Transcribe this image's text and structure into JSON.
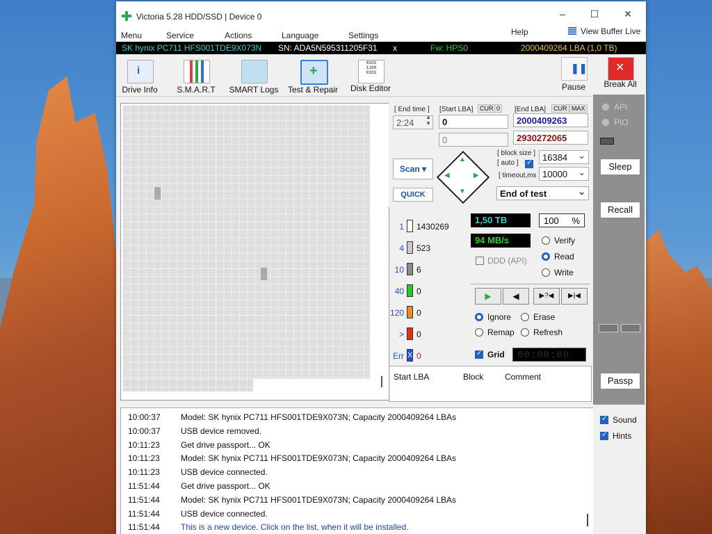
{
  "window": {
    "title": "Victoria 5.28 HDD/SSD | Device 0"
  },
  "menu": {
    "items": [
      "Menu",
      "Service",
      "Actions",
      "Language",
      "Settings"
    ],
    "help": "Help",
    "view_buffer": "View Buffer Live"
  },
  "drive_bar": {
    "model": "SK hynix PC711 HFS001TDE9X073N",
    "serial": "SN: ADA5N595311205F31",
    "close": "x",
    "firmware": "Fw: HPS0",
    "lba": "2000409264 LBA (1,0 TB)"
  },
  "toolbar": {
    "drive_info": "Drive Info",
    "smart": "S.M.A.R.T",
    "smart_logs": "SMART Logs",
    "test_repair": "Test & Repair",
    "disk_editor": "Disk Editor",
    "pause": "Pause",
    "break_all": "Break All"
  },
  "controls": {
    "end_time_label": "[ End time ]",
    "end_time": "2:24",
    "start_lba_label": "[Start LBA]",
    "cur_label": "CUR",
    "start_lba_cur": "0",
    "start_lba": "0",
    "start_lba2": "0",
    "end_lba_label": "[End LBA]",
    "cur2_label": "CUR",
    "max_label": "MAX",
    "end_lba": "2000409263",
    "end_lba2": "2930272065",
    "block_size_label": "[ block size ]",
    "auto_label": "[ auto ]",
    "block_size": "16384",
    "timeout_label": "[ timeout,ms ]",
    "timeout": "10000",
    "scan": "Scan",
    "quick": "QUICK",
    "end_of_test": "End of test"
  },
  "stats": {
    "categories": [
      {
        "label": "1",
        "count": "1430269",
        "color": "#ffffff"
      },
      {
        "label": "4",
        "count": "523",
        "color": "#c8c8c8"
      },
      {
        "label": "10",
        "count": "6",
        "color": "#8c8c8c"
      },
      {
        "label": "40",
        "count": "0",
        "color": "#22cc22"
      },
      {
        "label": "120",
        "count": "0",
        "color": "#f08a1e"
      },
      {
        "label": ">",
        "count": "0",
        "color": "#e0311f"
      },
      {
        "label": "Err",
        "count": "0",
        "color": "#1f4fd6"
      }
    ],
    "err_mark": "X",
    "size": "1,50 TB",
    "percent": "100",
    "percent_sign": "%",
    "speed": "94 MB/s",
    "ddd": "DDD (API)",
    "verify": "Verify",
    "read": "Read",
    "write": "Write",
    "ignore": "Ignore",
    "erase": "Erase",
    "remap": "Remap",
    "refresh": "Refresh",
    "grid": "Grid",
    "timer": "00:00:00"
  },
  "table": {
    "headers": [
      "Start LBA",
      "Block",
      "Comment"
    ]
  },
  "right": {
    "api": "API",
    "pio": "PIO",
    "sleep": "Sleep",
    "recall": "Recall",
    "passp": "Passp",
    "sound": "Sound",
    "hints": "Hints"
  },
  "log": [
    {
      "time": "10:00:37",
      "msg": "Model: SK hynix PC711 HFS001TDE9X073N; Capacity 2000409264 LBAs"
    },
    {
      "time": "10:00:37",
      "msg": "USB device removed."
    },
    {
      "time": "10:11:23",
      "msg": "Get drive passport... OK"
    },
    {
      "time": "10:11:23",
      "msg": "Model: SK hynix PC711 HFS001TDE9X073N; Capacity 2000409264 LBAs"
    },
    {
      "time": "10:11:23",
      "msg": "USB device connected."
    },
    {
      "time": "11:51:44",
      "msg": "Get drive passport... OK"
    },
    {
      "time": "11:51:44",
      "msg": "Model: SK hynix PC711 HFS001TDE9X073N; Capacity 2000409264 LBAs"
    },
    {
      "time": "11:51:44",
      "msg": "USB device connected."
    },
    {
      "time": "11:51:44",
      "msg": "This is a new device. Click on the list, when it will be installed.",
      "highlight": true
    }
  ],
  "colors": {
    "accent": "#1f63c6",
    "drivebar_text": "#35d0d0",
    "fw_text": "#2bd12b",
    "lba_text": "#e6c23a",
    "end_lba": "#1a1a9c",
    "end_lba2": "#8a1010"
  }
}
